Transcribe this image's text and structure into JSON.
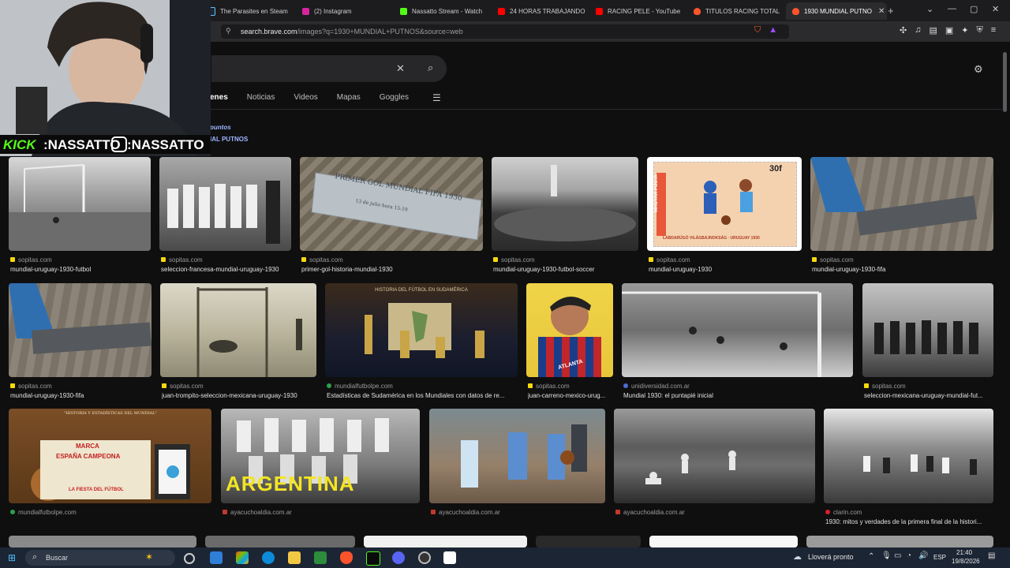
{
  "tabs": [
    {
      "label": "The Parasites en Steam",
      "color": "#1b2838"
    },
    {
      "label": "(2) Instagram",
      "color": "#d6249f"
    },
    {
      "label": "Nassatto Stream - Watch",
      "color": "#53fc18"
    },
    {
      "label": "24 HORAS TRABAJANDO",
      "color": "#ff0000"
    },
    {
      "label": "RACING PELE - YouTube",
      "color": "#ff0000"
    },
    {
      "label": "TITULOS RACING TOTAL",
      "color": "#fb542b"
    },
    {
      "label": "1930 MUNDIAL PUTNO",
      "color": "#fb542b"
    }
  ],
  "window_controls": {
    "tab_search": "⌄",
    "minimize": "—",
    "maximize": "▢",
    "close": "✕",
    "new_tab": "+"
  },
  "address": {
    "host": "search.brave.com",
    "path": "/images?q=1930+MUNDIAL+PUTNOS&source=web"
  },
  "search": {
    "clear": "✕",
    "submit": "⌕"
  },
  "nav_tabs": [
    "enes",
    "Noticias",
    "Videos",
    "Mapas",
    "Goggles"
  ],
  "alt_query": {
    "line1": "puntos",
    "line2": "IAL PUTNOS"
  },
  "results": [
    {
      "source": "sopitas.com",
      "title": "mundial-uruguay-1930-futbol",
      "fav": "#f5d90a"
    },
    {
      "source": "sopitas.com",
      "title": "seleccion-francesa-mundial-uruguay-1930",
      "fav": "#f5d90a"
    },
    {
      "source": "sopitas.com",
      "title": "primer-gol-historia-mundial-1930",
      "fav": "#f5d90a"
    },
    {
      "source": "sopitas.com",
      "title": "mundial-uruguay-1930-futbol-soccer",
      "fav": "#f5d90a"
    },
    {
      "source": "sopitas.com",
      "title": "mundial-uruguay-1930",
      "fav": "#f5d90a"
    },
    {
      "source": "sopitas.com",
      "title": "mundial-uruguay-1930-fifa",
      "fav": "#f5d90a"
    },
    {
      "source": "sopitas.com",
      "title": "mundial-uruguay-1930-fifa",
      "fav": "#f5d90a"
    },
    {
      "source": "sopitas.com",
      "title": "juan-trompito-seleccion-mexicana-uruguay-1930",
      "fav": "#f5d90a"
    },
    {
      "source": "mundialfutbolpe.com",
      "title": "Estadísticas de Sudamérica en los Mundiales con datos de re...",
      "fav": "#2e9f4a"
    },
    {
      "source": "sopitas.com",
      "title": "juan-carreno-mexico-urug...",
      "fav": "#f5d90a"
    },
    {
      "source": "unidiversidad.com.ar",
      "title": "Mundial 1930: el puntapié inicial",
      "fav": "#4a6fd1"
    },
    {
      "source": "sopitas.com",
      "title": "seleccion-mexicana-uruguay-mundial-fut...",
      "fav": "#f5d90a"
    },
    {
      "source": "mundialfutbolpe.com",
      "title": "",
      "fav": "#2e9f4a"
    },
    {
      "source": "ayacuchoaldia.com.ar",
      "title": "",
      "fav": "#c0392b"
    },
    {
      "source": "ayacuchoaldia.com.ar",
      "title": "",
      "fav": "#c0392b"
    },
    {
      "source": "ayacuchoaldia.com.ar",
      "title": "",
      "fav": "#c0392b"
    },
    {
      "source": "clarin.com",
      "title": "1930: mitos y verdades de la primera final de la histori...",
      "fav": "#d6202a"
    }
  ],
  "thumb_texts": {
    "plaque": "PRIMER GOL MUNDIAL FIFA 1930",
    "plaque_sub": "13 de julio hora 15:19",
    "stamp_price": "30f",
    "stamp_country": "MAGYAR POSTA",
    "stamp_caption": "LABDARÚGÓ VILÁGBAJNOKSÁG · URUGUAY 1930",
    "museum": "HISTORIA DEL FÚTBOL EN SUDAMÉRICA",
    "book1": "MARCA",
    "book2": "ESPAÑA CAMPEONA",
    "book3": "LA FIESTA DEL FÚTBOL",
    "argentina": "ARGENTINA",
    "atlanta": "ATLANTA"
  },
  "overlay": {
    "kick_logo": "KICK",
    "kick_handle": ":NASSATTO",
    "ig_handle": ":NASSATTO"
  },
  "taskbar": {
    "search_placeholder": "Buscar",
    "weather": "Lloverá pronto",
    "lang": "ESP",
    "time": "21:40",
    "date": "19/8/2026"
  }
}
